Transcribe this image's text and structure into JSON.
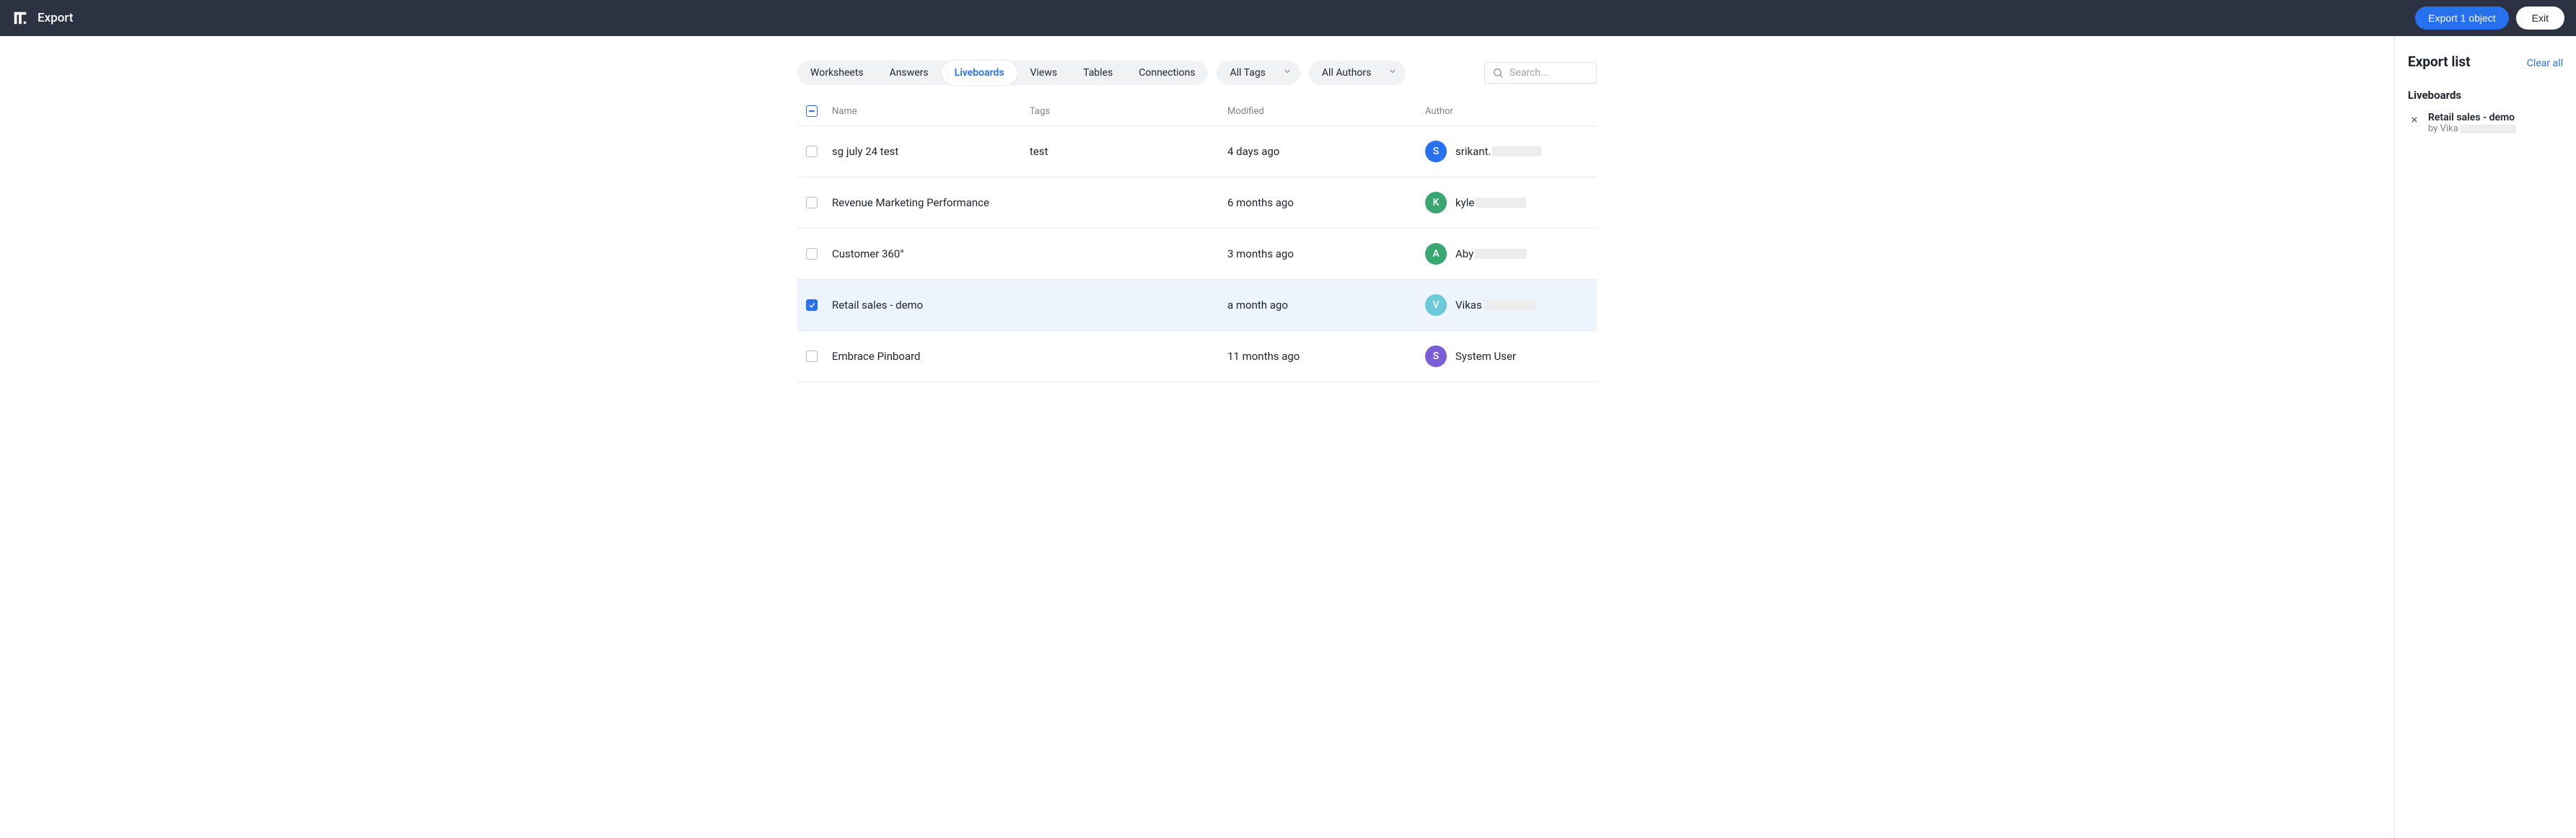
{
  "header": {
    "title": "Export",
    "export_button": "Export 1 object",
    "exit_button": "Exit"
  },
  "tabs": [
    "Worksheets",
    "Answers",
    "Liveboards",
    "Views",
    "Tables",
    "Connections"
  ],
  "active_tab": "Liveboards",
  "filters": {
    "tags_label": "All Tags",
    "authors_label": "All Authors"
  },
  "search": {
    "placeholder": "Search..."
  },
  "columns": {
    "name": "Name",
    "tags": "Tags",
    "modified": "Modified",
    "author": "Author"
  },
  "rows": [
    {
      "selected": false,
      "name": "sg july 24 test",
      "tags": "test",
      "modified": "4 days ago",
      "author_initial": "S",
      "author_name": "srikant.",
      "author_redact_w": 68,
      "avatar_color": "#2770ef"
    },
    {
      "selected": false,
      "name": "Revenue Marketing Performance",
      "tags": "",
      "modified": "6 months ago",
      "author_initial": "K",
      "author_name": "kyle",
      "author_redact_w": 70,
      "avatar_color": "#3aa772"
    },
    {
      "selected": false,
      "name": "Customer 360°",
      "tags": "",
      "modified": "3 months ago",
      "author_initial": "A",
      "author_name": "Aby",
      "author_redact_w": 72,
      "avatar_color": "#3aa772"
    },
    {
      "selected": true,
      "name": "Retail sales - demo",
      "tags": "",
      "modified": "a month ago",
      "author_initial": "V",
      "author_name": "Vikas",
      "author_redact_w": 72,
      "avatar_color": "#6bc9d8"
    },
    {
      "selected": false,
      "name": "Embrace Pinboard",
      "tags": "",
      "modified": "11 months ago",
      "author_initial": "S",
      "author_name": "System User",
      "author_redact_w": 0,
      "avatar_color": "#7b5ed6"
    }
  ],
  "sidebar": {
    "title": "Export list",
    "clear_all": "Clear all",
    "section_title": "Liveboards",
    "items": [
      {
        "title": "Retail sales - demo",
        "by_prefix": "by Vika",
        "redact_w": 78
      }
    ]
  }
}
